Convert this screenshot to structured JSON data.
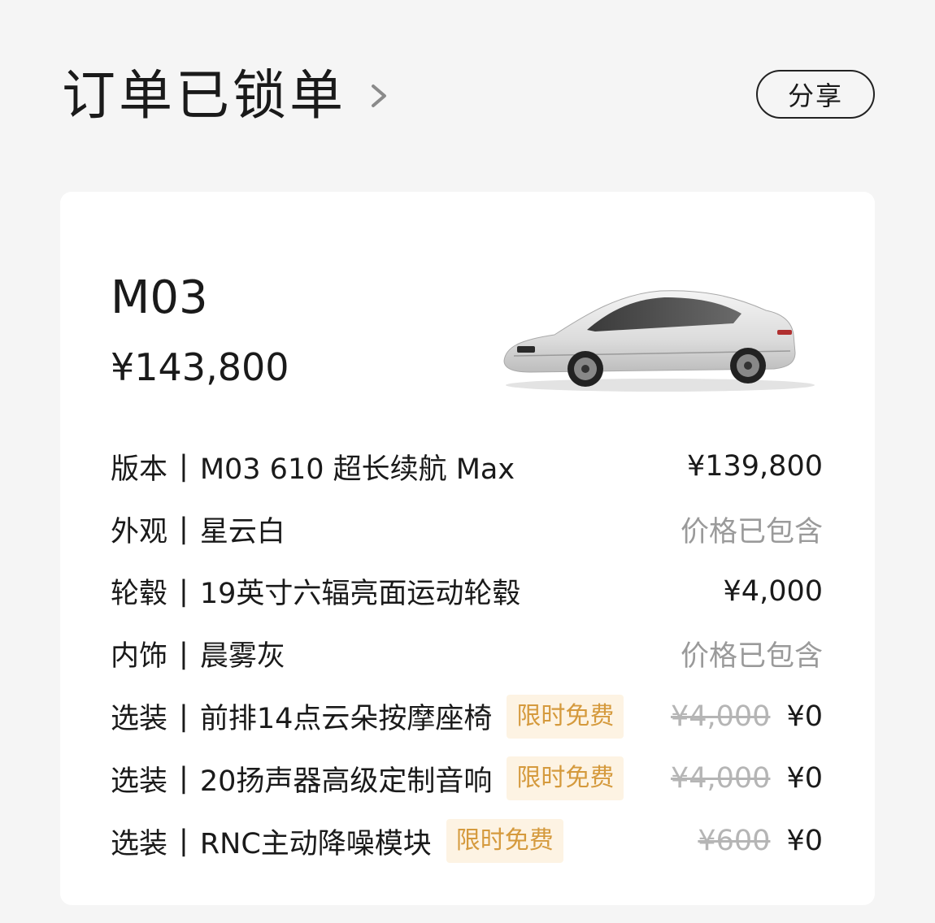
{
  "header": {
    "title": "订单已锁单",
    "share_label": "分享"
  },
  "vehicle": {
    "model": "M03",
    "price": "¥143,800"
  },
  "separator": "|",
  "rows": [
    {
      "label": "版本",
      "value": "M03 610 超长续航 Max",
      "price": "¥139,800"
    },
    {
      "label": "外观",
      "value": "星云白",
      "price": "价格已包含"
    },
    {
      "label": "轮毂",
      "value": "19英寸六辐亮面运动轮毂",
      "price": "¥4,000"
    },
    {
      "label": "内饰",
      "value": "晨雾灰",
      "price": "价格已包含"
    },
    {
      "label": "选装",
      "value": "前排14点云朵按摩座椅",
      "badge": "限时免费",
      "original_price": "¥4,000",
      "price": "¥0"
    },
    {
      "label": "选装",
      "value": "20扬声器高级定制音响",
      "badge": "限时免费",
      "original_price": "¥4,000",
      "price": "¥0"
    },
    {
      "label": "选装",
      "value": "RNC主动降噪模块",
      "badge": "限时免费",
      "original_price": "¥600",
      "price": "¥0"
    }
  ],
  "colors": {
    "background": "#f5f5f5",
    "card": "#ffffff",
    "text": "#1a1a1a",
    "muted": "#9a9a9a",
    "badge_bg": "#fdf3e3",
    "badge_text": "#d59a3d",
    "strike": "#b5b5b5"
  },
  "icons": {
    "title_chevron": "chevron-right-icon"
  }
}
